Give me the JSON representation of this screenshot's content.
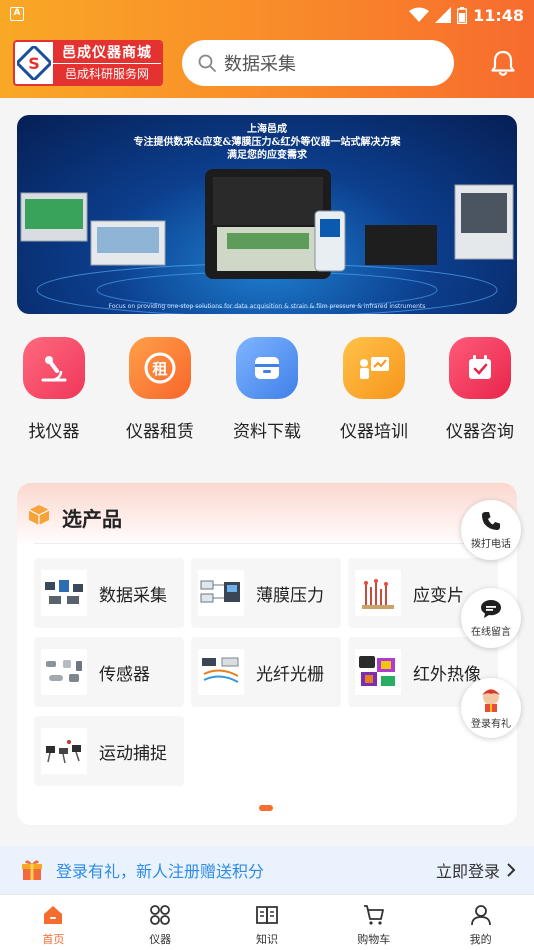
{
  "status_bar": {
    "left_badge": "A",
    "time": "11:48"
  },
  "header": {
    "logo": {
      "line1": "邑成仪器商城",
      "line2": "邑成科研服务网"
    },
    "search": {
      "text": "数据采集"
    }
  },
  "banner": {
    "title_line1": "上海邑成",
    "title_line2": "专注提供数采&应变&薄膜压力&红外等仪器一站式解决方案",
    "title_line3": "满足您的应变需求"
  },
  "categories": [
    {
      "label": "找仪器",
      "icon": "microscope-icon",
      "color": "#f04764"
    },
    {
      "label": "仪器租赁",
      "icon": "rent-icon",
      "color": "#f97b2e"
    },
    {
      "label": "资料下载",
      "icon": "download-box-icon",
      "color": "#4a90f0"
    },
    {
      "label": "仪器培训",
      "icon": "training-icon",
      "color": "#f9a11b"
    },
    {
      "label": "仪器咨询",
      "icon": "calendar-check-icon",
      "color": "#f0365a"
    }
  ],
  "products": {
    "title": "选产品",
    "items": [
      {
        "label": "数据采集",
        "icon": "data-acquisition-icon"
      },
      {
        "label": "薄膜压力",
        "icon": "film-pressure-icon"
      },
      {
        "label": "应变片",
        "icon": "strain-gauge-icon"
      },
      {
        "label": "传感器",
        "icon": "sensor-icon"
      },
      {
        "label": "光纤光栅",
        "icon": "fiber-grating-icon"
      },
      {
        "label": "红外热像",
        "icon": "thermal-camera-icon"
      },
      {
        "label": "运动捕捉",
        "icon": "motion-capture-icon"
      }
    ]
  },
  "floating": {
    "call": "拨打电话",
    "message": "在线留言",
    "gift": "登录有礼"
  },
  "promo": {
    "text": "登录有礼，新人注册赠送积分",
    "action": "立即登录"
  },
  "tabbar": [
    {
      "label": "首页",
      "icon": "home-icon",
      "active": true
    },
    {
      "label": "仪器",
      "icon": "grid-icon",
      "active": false
    },
    {
      "label": "知识",
      "icon": "book-icon",
      "active": false
    },
    {
      "label": "购物车",
      "icon": "cart-icon",
      "active": false
    },
    {
      "label": "我的",
      "icon": "user-icon",
      "active": false
    }
  ],
  "colors": {
    "accent": "#f76b2e",
    "promo_text": "#2f8be6",
    "brand_red": "#e3322f"
  }
}
